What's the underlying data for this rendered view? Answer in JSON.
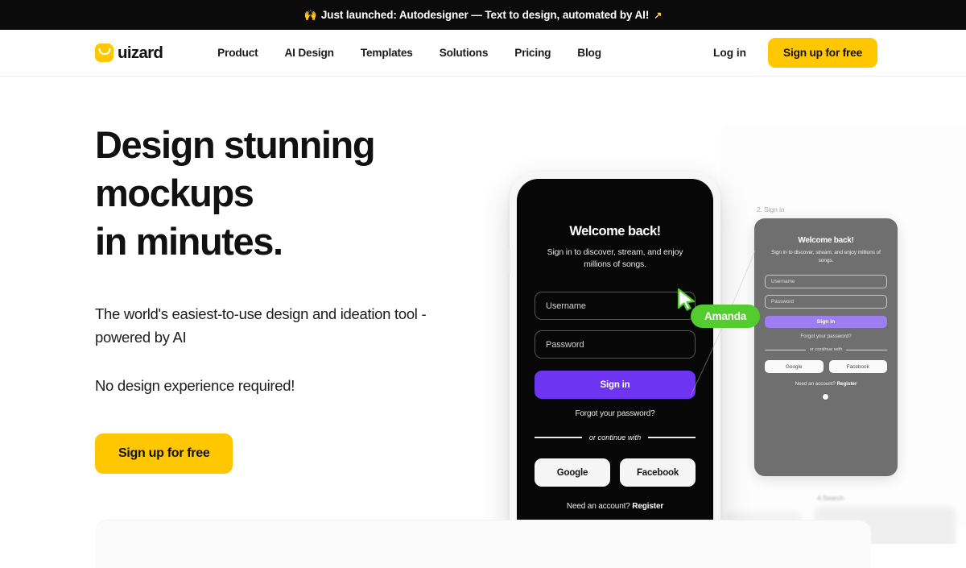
{
  "banner": {
    "emoji": "🙌",
    "text": "Just launched: Autodesigner — Text to design, automated by AI!",
    "trailing_icon": "↗"
  },
  "header": {
    "logo_text": "uizard",
    "logo_icon": "uizard-smile-icon",
    "nav": [
      {
        "label": "Product"
      },
      {
        "label": "AI Design"
      },
      {
        "label": "Templates"
      },
      {
        "label": "Solutions"
      },
      {
        "label": "Pricing"
      },
      {
        "label": "Blog"
      }
    ],
    "login_label": "Log in",
    "signup_label": "Sign up for free"
  },
  "hero": {
    "headline_line1": "Design stunning",
    "headline_line2": "mockups",
    "headline_line3": "in minutes.",
    "subtitle": "The world's easiest-to-use design and ideation tool - powered by AI",
    "tagline": "No design experience required!",
    "cta_label": "Sign up for free"
  },
  "mockup": {
    "phone_screen": {
      "title": "Welcome back!",
      "subtitle": "Sign in to discover, stream, and enjoy millions of songs.",
      "username_placeholder": "Username",
      "password_placeholder": "Password",
      "signin_label": "Sign in",
      "forgot_label": "Forgot your password?",
      "divider_label": "or continue with",
      "social": [
        {
          "label": "Google"
        },
        {
          "label": "Facebook"
        }
      ],
      "footer_prefix": "Need an account? ",
      "footer_link": "Register"
    },
    "artboard_2": {
      "label": "2. Sign in",
      "title": "Welcome back!",
      "subtitle": "Sign in to discover, stream, and enjoy millions of songs.",
      "username_placeholder": "Username",
      "password_placeholder": "Password",
      "signin_label": "Sign in",
      "forgot_label": "Forgot your password?",
      "divider_label": "or continue with",
      "social": [
        {
          "label": "Google"
        },
        {
          "label": "Facebook"
        }
      ],
      "footer_prefix": "Need an account? ",
      "footer_link": "Register"
    },
    "artboard_4": {
      "label": "4.Search"
    },
    "cursor": {
      "name": "Amanda",
      "color": "#52cc2e"
    }
  },
  "colors": {
    "brand_yellow": "#ffc700",
    "banner_black": "#0b0b0b",
    "accent_purple": "#6d34f2",
    "cursor_green": "#52cc2e"
  }
}
